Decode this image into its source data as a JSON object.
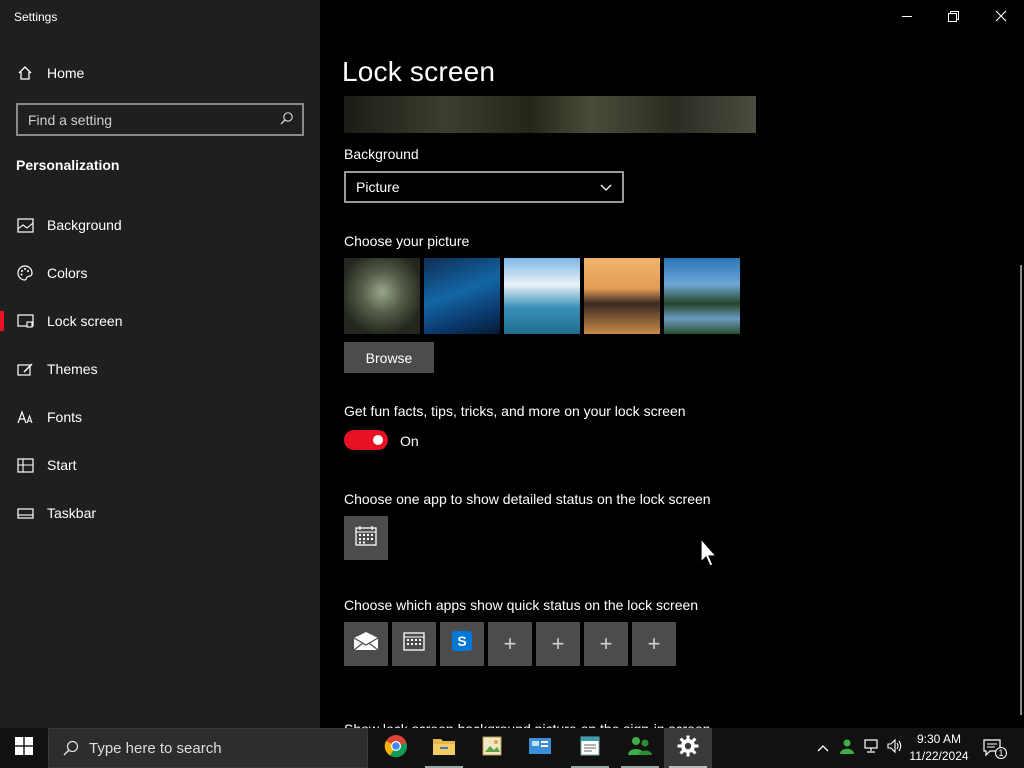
{
  "window": {
    "title": "Settings",
    "controls": {
      "minimize": "minimize",
      "restore": "restore",
      "close": "close"
    }
  },
  "sidebar": {
    "home_label": "Home",
    "search_placeholder": "Find a setting",
    "section_title": "Personalization",
    "items": [
      {
        "label": "Background",
        "icon": "picture-icon"
      },
      {
        "label": "Colors",
        "icon": "palette-icon"
      },
      {
        "label": "Lock screen",
        "icon": "lock-screen-icon",
        "active": true
      },
      {
        "label": "Themes",
        "icon": "brush-icon"
      },
      {
        "label": "Fonts",
        "icon": "font-icon"
      },
      {
        "label": "Start",
        "icon": "start-grid-icon"
      },
      {
        "label": "Taskbar",
        "icon": "taskbar-icon"
      }
    ],
    "accent_color": "#e81123"
  },
  "main": {
    "page_title": "Lock screen",
    "background_label": "Background",
    "background_value": "Picture",
    "choose_picture_label": "Choose your picture",
    "browse_label": "Browse",
    "fun_facts_label": "Get fun facts, tips, tricks, and more on your lock screen",
    "fun_facts_state": "On",
    "detailed_status_label": "Choose one app to show detailed status on the lock screen",
    "quick_status_label": "Choose which apps show quick status on the lock screen",
    "quick_status_apps": [
      "mail-icon",
      "calendar-icon",
      "skype-icon",
      "plus-icon",
      "plus-icon",
      "plus-icon",
      "plus-icon"
    ],
    "signin_label": "Show lock screen background picture on the sign-in screen"
  },
  "taskbar": {
    "search_placeholder": "Type here to search",
    "apps": [
      "chrome-icon",
      "file-explorer-icon",
      "photo-viewer-icon",
      "control-panel-icon",
      "notepad-icon",
      "people-icon",
      "settings-gear-icon"
    ],
    "clock_time": "9:30 AM",
    "clock_date": "11/22/2024",
    "notification_count": "1"
  }
}
